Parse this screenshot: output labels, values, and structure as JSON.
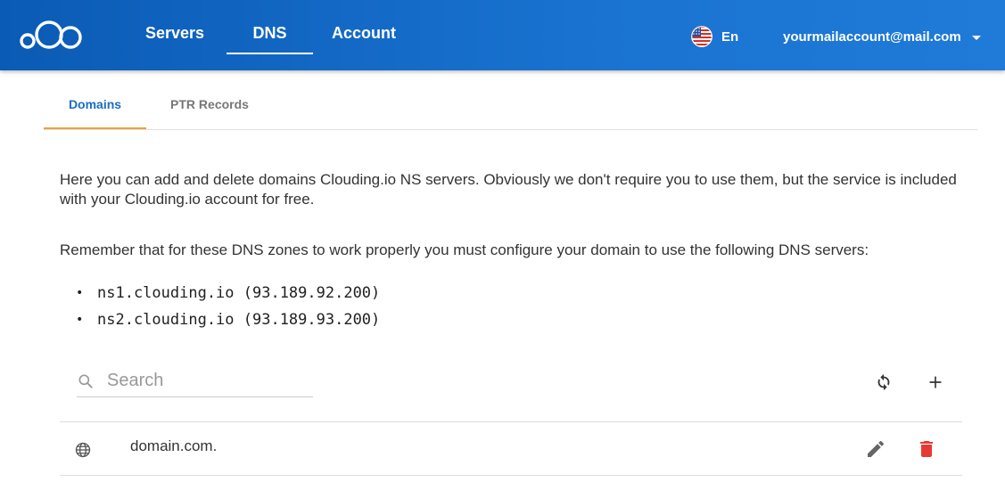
{
  "nav": {
    "items": [
      {
        "label": "Servers"
      },
      {
        "label": "DNS",
        "active": true
      },
      {
        "label": "Account"
      }
    ],
    "language": "En",
    "account_email": "yourmailaccount@mail.com"
  },
  "tabs": [
    {
      "label": "Domains",
      "active": true
    },
    {
      "label": "PTR Records"
    }
  ],
  "intro": {
    "paragraph1": "Here you can add and delete domains Clouding.io NS servers. Obviously we don't require you to use them, but the service is included with your Clouding.io account for free.",
    "paragraph2": "Remember that for these DNS zones to work properly you must configure your domain to use the following DNS servers:",
    "ns_servers": [
      "ns1.clouding.io (93.189.92.200)",
      "ns2.clouding.io (93.189.93.200)"
    ]
  },
  "search": {
    "placeholder": "Search",
    "value": ""
  },
  "domains": [
    {
      "name": "domain.com."
    }
  ],
  "colors": {
    "header": "#1a73d1",
    "active_tab_text": "#1a6dc4",
    "active_tab_underline": "#e8a33a",
    "delete": "#e53935"
  }
}
